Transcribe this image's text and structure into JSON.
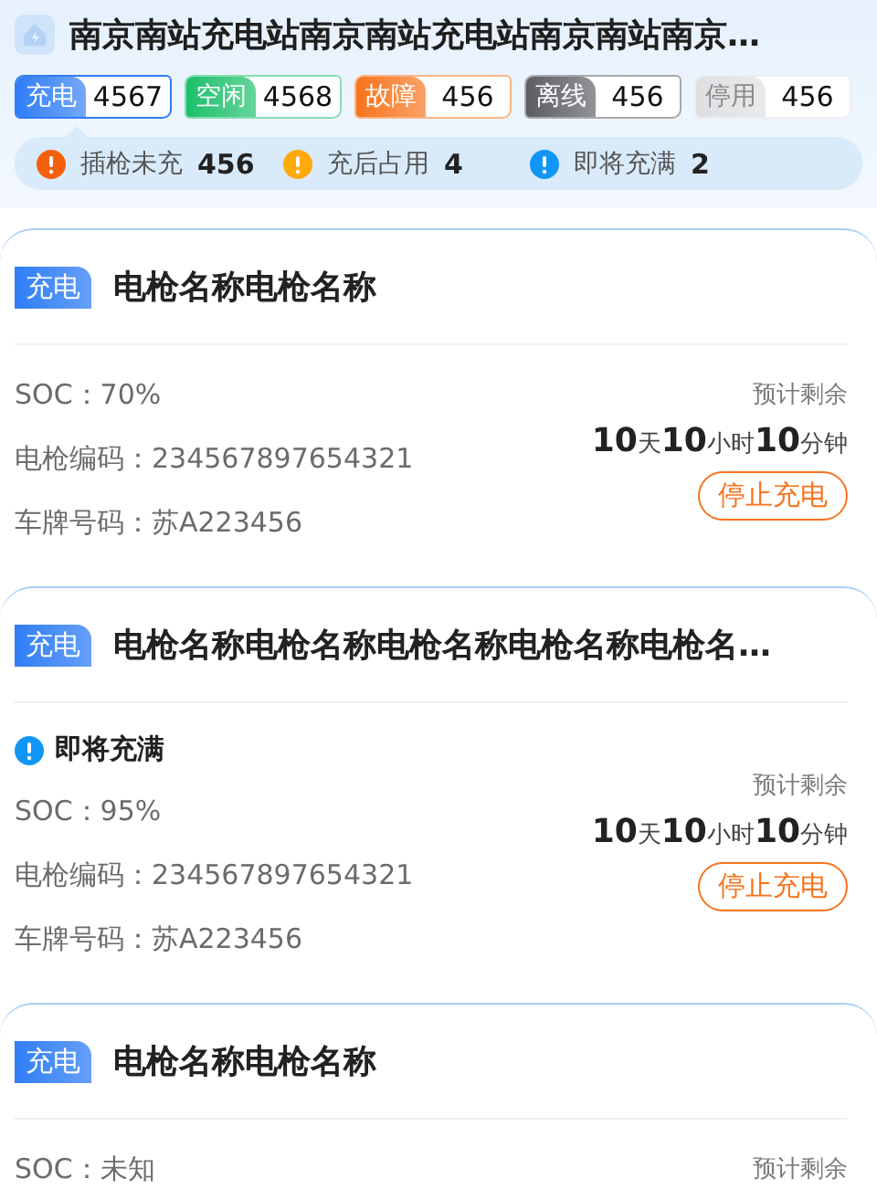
{
  "station": {
    "title": "南京南站充电站南京南站充电站南京南站南京…"
  },
  "status_tabs": [
    {
      "label": "充电",
      "count": "4567",
      "color": "#2f7df6",
      "selected": true
    },
    {
      "label": "空闲",
      "count": "4568",
      "color": "#1cbf6b",
      "selected": false
    },
    {
      "label": "故障",
      "count": "456",
      "color": "#f7731c",
      "selected": false
    },
    {
      "label": "离线",
      "count": "456",
      "color": "#5b5d63",
      "selected": false
    },
    {
      "label": "停用",
      "count": "456",
      "color": "#dedfe2",
      "selected": false
    }
  ],
  "alerts": [
    {
      "label": "插枪未充",
      "count": "456",
      "color": "#f4600c"
    },
    {
      "label": "充后占用",
      "count": "4",
      "color": "#ffa90a"
    },
    {
      "label": "即将充满",
      "count": "2",
      "color": "#1296f5"
    }
  ],
  "cards": [
    {
      "badge": {
        "label": "充电",
        "color": "#2f7df6"
      },
      "name": "电枪名称电枪名称",
      "fields": [
        "SOC：70%",
        "电枪编码：234567897654321",
        "车牌号码：苏A223456"
      ],
      "remaining": {
        "label": "预计剩余",
        "parts": [
          {
            "value": "10",
            "unit": "天"
          },
          {
            "value": "10",
            "unit": "小时"
          },
          {
            "value": "10",
            "unit": "分钟"
          }
        ]
      },
      "button": "停止充电"
    },
    {
      "badge": {
        "label": "充电",
        "color": "#2f7df6"
      },
      "name": "电枪名称电枪名称电枪名称电枪名称电枪名…",
      "notice": {
        "label": "即将充满",
        "color": "#1296f5"
      },
      "fields": [
        "SOC：95%",
        "电枪编码：234567897654321",
        "车牌号码：苏A223456"
      ],
      "remaining": {
        "label": "预计剩余",
        "parts": [
          {
            "value": "10",
            "unit": "天"
          },
          {
            "value": "10",
            "unit": "小时"
          },
          {
            "value": "10",
            "unit": "分钟"
          }
        ]
      },
      "button": "停止充电"
    },
    {
      "badge": {
        "label": "充电",
        "color": "#2f7df6"
      },
      "name": "电枪名称电枪名称",
      "fields": [
        "SOC：未知"
      ],
      "remaining": {
        "label": "预计剩余"
      }
    }
  ]
}
